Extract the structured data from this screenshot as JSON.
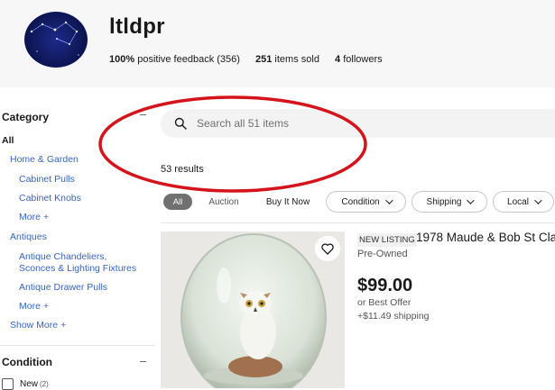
{
  "store": {
    "name": "ltldpr",
    "feedback_pct": "100%",
    "feedback_label": "positive feedback (356)",
    "items_sold": "251",
    "items_sold_label": "items sold",
    "followers": "4",
    "followers_label": "followers"
  },
  "sidebar": {
    "category_title": "Category",
    "all": "All",
    "home_garden": "Home & Garden",
    "cabinet_pulls": "Cabinet Pulls",
    "cabinet_knobs": "Cabinet Knobs",
    "more1": "More",
    "antiques": "Antiques",
    "chandeliers_l1": "Antique Chandeliers,",
    "chandeliers_l2": "Sconces & Lighting Fixtures",
    "drawer_pulls": "Antique Drawer Pulls",
    "more2": "More",
    "show_more": "Show More",
    "condition_title": "Condition",
    "new_label": "New",
    "new_count": "(2)"
  },
  "search": {
    "placeholder": "Search all 51 items"
  },
  "results_text": "53 results",
  "filters": {
    "all": "All",
    "auction": "Auction",
    "buy_it_now": "Buy It Now",
    "condition": "Condition",
    "shipping": "Shipping",
    "local": "Local"
  },
  "listing": {
    "badge": "NEW LISTING",
    "title": "1978 Maude & Bob St Cla",
    "condition": "Pre-Owned",
    "price": "$99.00",
    "offer": "or Best Offer",
    "shipping": "+$11.49 shipping"
  },
  "colors": {
    "link": "#3665c2",
    "annotation": "#d4131a",
    "pill_active": "#707070"
  }
}
